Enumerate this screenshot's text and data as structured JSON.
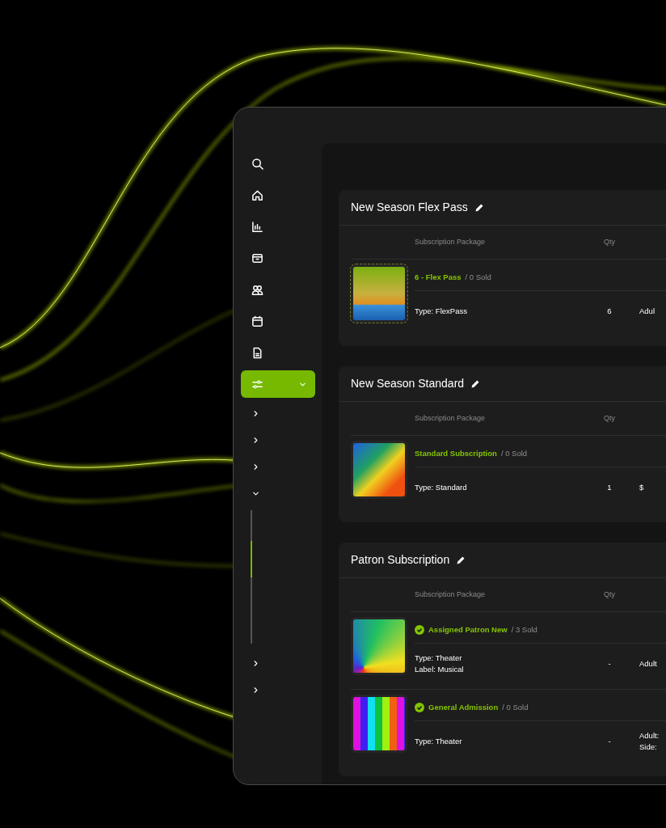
{
  "sidebar": {
    "items": [
      {
        "kind": "search",
        "selected": false
      },
      {
        "kind": "home",
        "selected": false
      },
      {
        "kind": "chart",
        "selected": false
      },
      {
        "kind": "archive",
        "selected": false
      },
      {
        "kind": "people",
        "selected": false
      },
      {
        "kind": "calendar",
        "selected": false
      },
      {
        "kind": "document",
        "selected": false
      },
      {
        "kind": "settings",
        "selected": true,
        "expanded": true
      },
      {
        "kind": "chevron",
        "expanded": false
      },
      {
        "kind": "chevron",
        "expanded": false
      },
      {
        "kind": "chevron",
        "expanded": false
      },
      {
        "kind": "chevron",
        "expanded": true
      },
      {
        "kind": "chevron",
        "expanded": false
      },
      {
        "kind": "chevron",
        "expanded": false
      }
    ]
  },
  "cards": [
    {
      "title": "New Season Flex Pass",
      "columns": [
        "Subscription Package",
        "Qty"
      ],
      "rows": [
        {
          "selected": true,
          "verified": false,
          "name": "6 - Flex Pass",
          "sold": "/ 0 Sold",
          "details": [
            "Type: FlexPass"
          ],
          "qty": "6",
          "column_3": [
            "Adul"
          ]
        }
      ]
    },
    {
      "title": "New Season Standard",
      "columns": [
        "Subscription Package",
        "Qty"
      ],
      "rows": [
        {
          "selected": false,
          "verified": false,
          "name": "Standard Subscription",
          "sold": "/ 0 Sold",
          "details": [
            "Type: Standard"
          ],
          "qty": "1",
          "column_3": [
            "$"
          ]
        }
      ]
    },
    {
      "title": "Patron Subscription",
      "columns": [
        "Subscription Package",
        "Qty"
      ],
      "rows": [
        {
          "selected": false,
          "verified": true,
          "name": "Assigned Patron New",
          "sold": "/ 3 Sold",
          "details": [
            "Type: Theater",
            "Label: Musical"
          ],
          "qty": "-",
          "column_3": [
            "Adult"
          ]
        },
        {
          "selected": false,
          "verified": true,
          "name": "General Admission",
          "sold": "/ 0 Sold",
          "details": [
            "Type: Theater"
          ],
          "qty": "-",
          "column_3": [
            "Adult:",
            "Side:"
          ]
        }
      ]
    }
  ]
}
